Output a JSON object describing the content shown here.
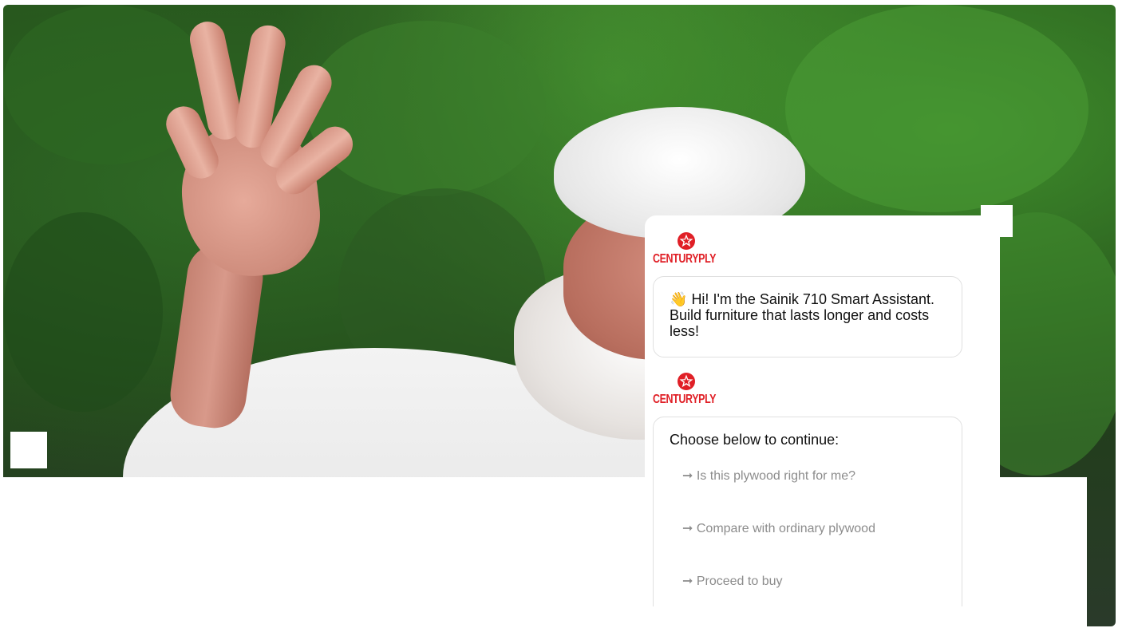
{
  "brand": {
    "logo_text": "CENTURYPLY",
    "accent_color": "#e01f26"
  },
  "chat": {
    "greeting": {
      "emoji": "👋",
      "text": "Hi! I'm the Sainik 710 Smart Assistant. Build furniture that lasts longer and costs less!"
    },
    "prompt": {
      "text": "Choose below to continue:",
      "arrow": "➞",
      "options": [
        "Is this plywood right for me?",
        "Compare with ordinary plywood",
        "Proceed to buy"
      ]
    }
  }
}
